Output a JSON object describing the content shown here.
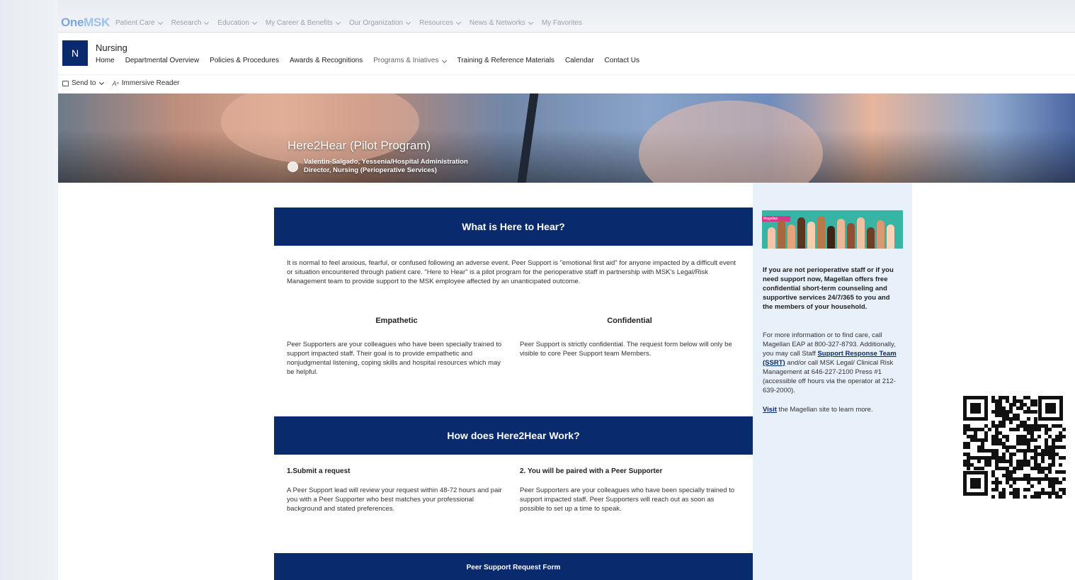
{
  "suite": {
    "logo_a": "One",
    "logo_b": "MSK",
    "nav": [
      "Patient Care",
      "Research",
      "Education",
      "My Career & Benefits",
      "Our Organization",
      "Resources",
      "News & Networks",
      "My Favorites"
    ]
  },
  "site": {
    "logo_letter": "N",
    "title": "Nursing",
    "nav": [
      "Home",
      "Departmental Overview",
      "Policies & Procedures",
      "Awards & Recognitions",
      "Programs & Iniatives",
      "Training & Reference Materials",
      "Calendar",
      "Contact Us"
    ]
  },
  "commands": {
    "send_to": "Send to",
    "immersive_reader": "Immersive Reader"
  },
  "hero": {
    "title": "Here2Hear (Pilot Program)",
    "author_line1": "Valentin-Salgado, Yessenia/Hospital Administration",
    "author_line2": "Director, Nursing (Perioperative Services)"
  },
  "section1": {
    "heading": "What is Here to Hear?",
    "intro": "It is normal to feel anxious, fearful, or confused following an adverse event. Peer Support is \"emotional first aid\" for anyone impacted by a difficult event or situation encountered through patient care. \"Here to Hear\" is a pilot program for the perioperative staff in partnership with MSK's Legal/Risk Management team to provide support to the MSK employee affected by an unanticipated outcome.",
    "col1_head": "Empathetic",
    "col1_text": "Peer Supporters are your colleagues who have been specially trained to support impacted staff.  Their goal is to provide empathetic and nonjudgmental listening, coping skills and hospital resources which may be helpful.",
    "col2_head": "Confidential",
    "col2_text": "Peer Support is strictly confidential. The request form below will only be visible to core Peer Support team Members."
  },
  "section2": {
    "heading": "How does Here2Hear Work?",
    "step1_head": "1.Submit a request",
    "step1_text": "A Peer Support lead will review your request within 48-72 hours and pair you with a Peer Supporter who best matches your professional background and stated preferences.",
    "step2_head": "2. You will be paired with a Peer Supporter",
    "step2_text": "Peer Supporters are your colleagues who have been specially trained to support impacted staff. Peer Supporters will reach out as soon as possible to set up a time to speak."
  },
  "section3": {
    "heading": "Peer Support Request Form"
  },
  "sidebar": {
    "image_tag": "Magellan",
    "bold_text": "If you are not perioperative staff or if you need support now, Magellan offers free confidential short-term counseling and supportive services 24/7/365 to you and the members of your household.",
    "info_pre": "For more information or to find care, call Magellan EAP at 800-327-8793. Additionally, you may call Staff ",
    "info_link": "Support Response Team (SSRT)",
    "info_post": " and/or call MSK Legal/ Clinical Risk Management at 646-227-2100 Press #1 (accessible off hours via the operator at 212-639-2000).",
    "visit_link": "Visit",
    "visit_text": " the Magellan site to learn more."
  },
  "colors": {
    "navy": "#0a2a6e",
    "sidebar_bg": "#e8f0fa",
    "teal": "#38b3a4"
  }
}
